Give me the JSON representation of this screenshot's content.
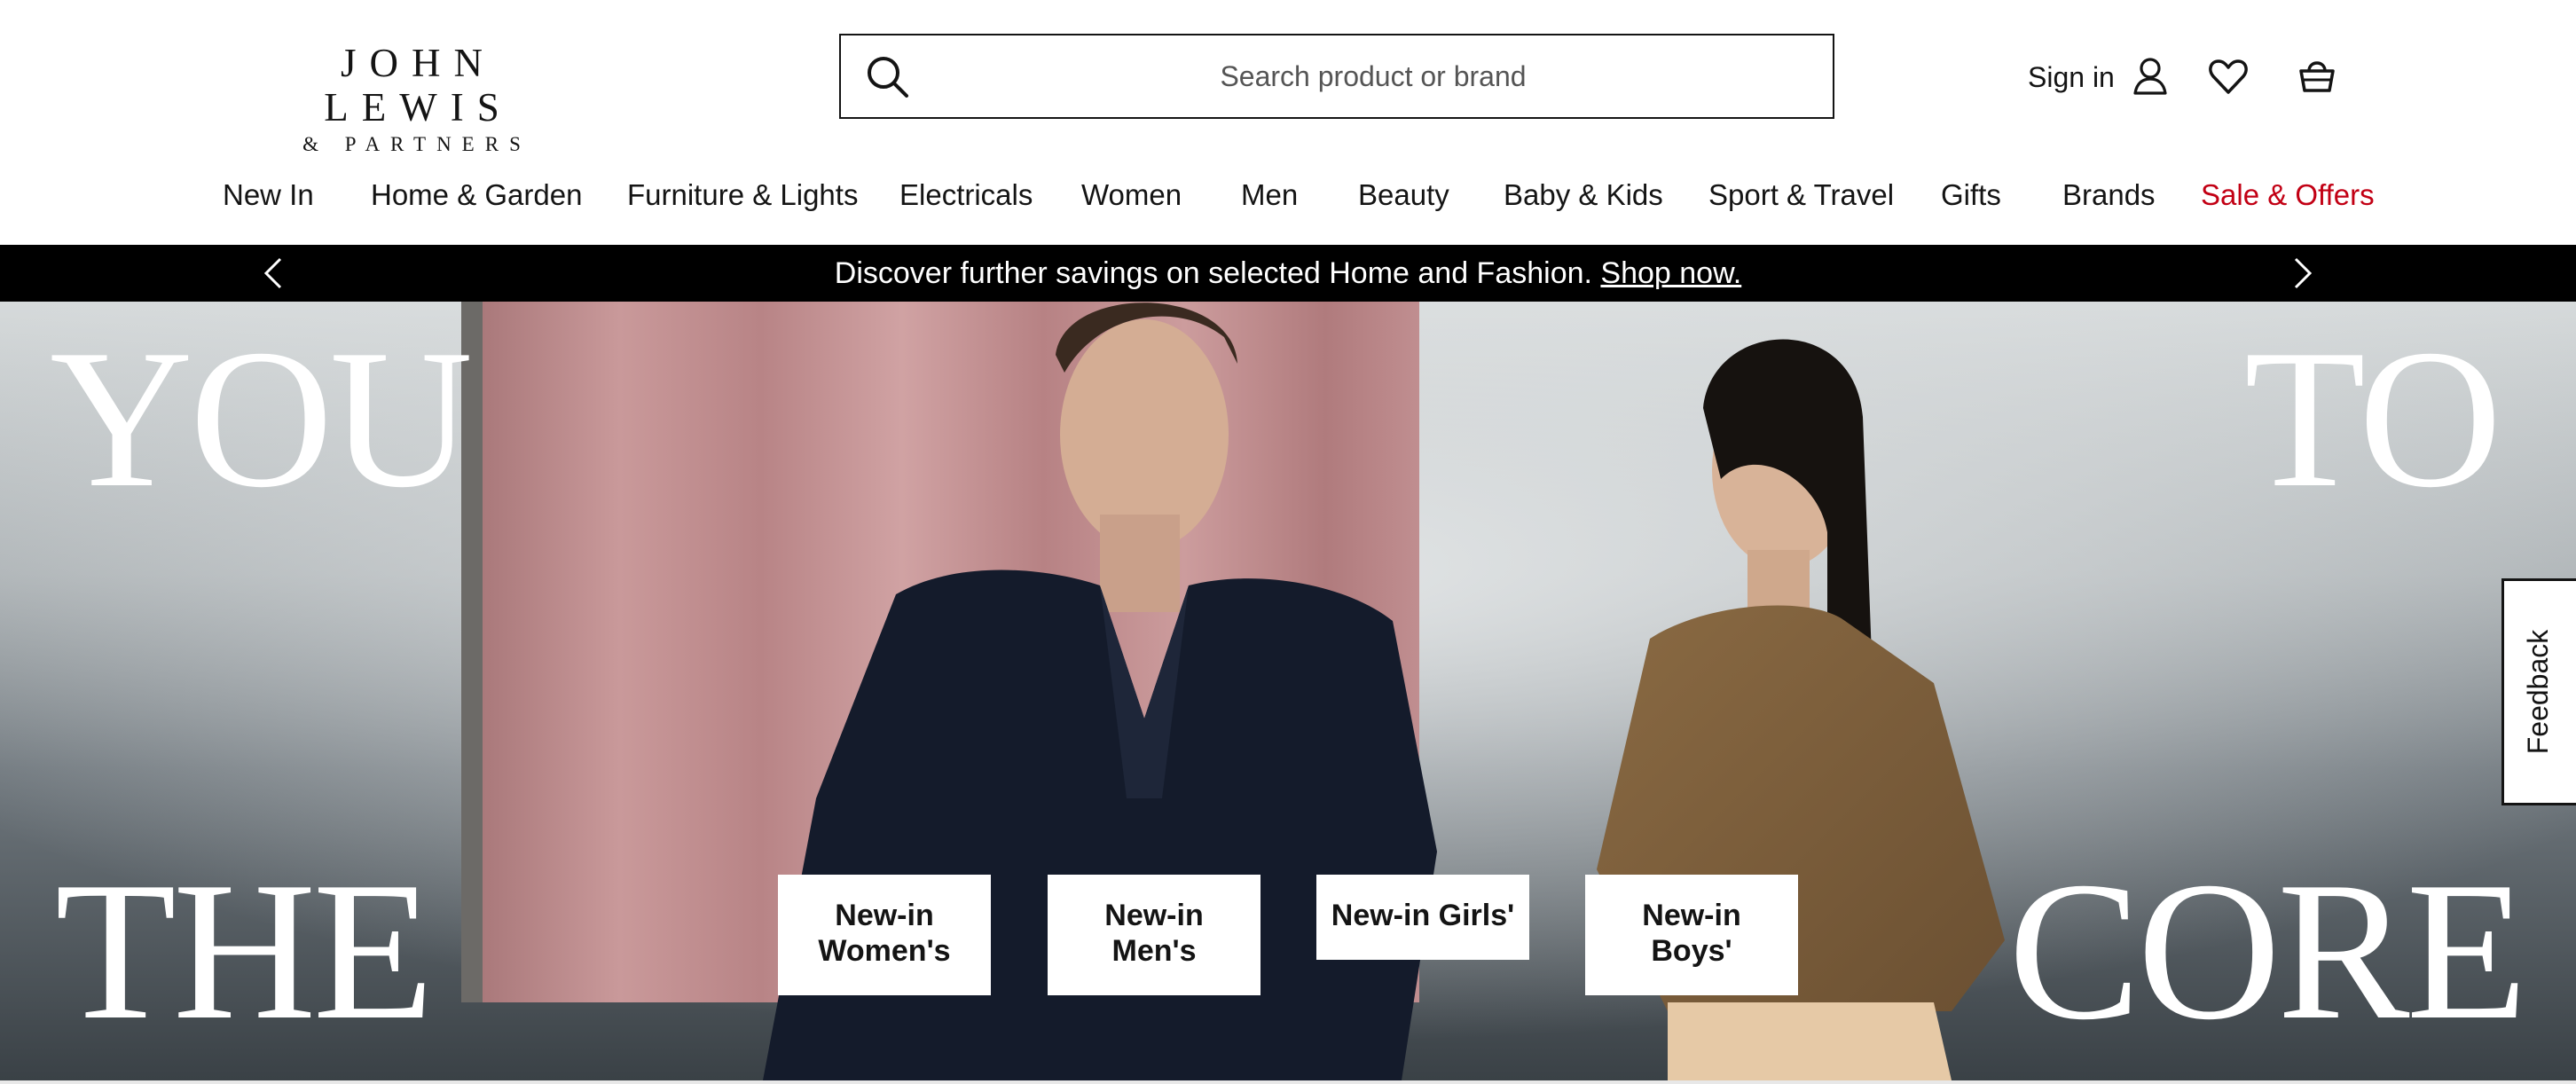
{
  "brand": {
    "logo_main": "JOHN LEWIS",
    "logo_sub": "& PARTNERS"
  },
  "search": {
    "placeholder": "Search product or brand",
    "value": ""
  },
  "account": {
    "signin_label": "Sign in"
  },
  "icons": {
    "search": "search-icon",
    "user": "user-icon",
    "wishlist": "heart-icon",
    "basket": "basket-icon",
    "prev": "chevron-left-icon",
    "next": "chevron-right-icon"
  },
  "nav": {
    "items": [
      {
        "label": "New In"
      },
      {
        "label": "Home & Garden"
      },
      {
        "label": "Furniture & Lights"
      },
      {
        "label": "Electricals"
      },
      {
        "label": "Women"
      },
      {
        "label": "Men"
      },
      {
        "label": "Beauty"
      },
      {
        "label": "Baby & Kids"
      },
      {
        "label": "Sport & Travel"
      },
      {
        "label": "Gifts"
      },
      {
        "label": "Brands"
      },
      {
        "label": "Sale & Offers"
      }
    ]
  },
  "promo": {
    "text": "Discover further savings on selected Home and Fashion.",
    "link": "Shop now."
  },
  "hero": {
    "words": [
      "YOU",
      "TO",
      "THE",
      "CORE"
    ],
    "ctas": [
      {
        "label": "New-in Women's"
      },
      {
        "label": "New-in Men's"
      },
      {
        "label": "New-in Girls'"
      },
      {
        "label": "New-in Boys'"
      }
    ]
  },
  "feedback": {
    "label": "Feedback"
  },
  "colors": {
    "text": "#141414",
    "sale": "#c20014",
    "promo_bg": "#000000",
    "white": "#ffffff"
  }
}
